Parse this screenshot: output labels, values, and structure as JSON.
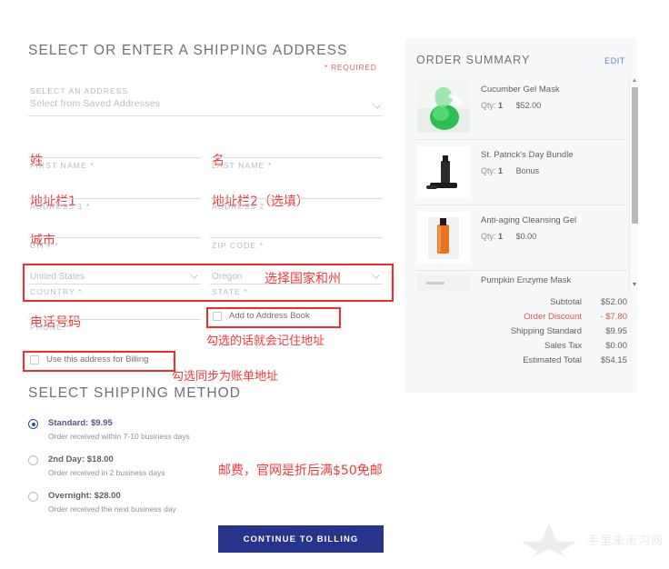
{
  "shipping_section": {
    "title": "SELECT OR ENTER A SHIPPING ADDRESS",
    "required_note": "* REQUIRED",
    "saved_address": {
      "label": "SELECT AN ADDRESS",
      "value": "Select from Saved Addresses"
    },
    "fields": [
      {
        "label": "FIRST NAME *",
        "value": "姓",
        "value_lang": "cn"
      },
      {
        "label": "LAST NAME *",
        "value": "名",
        "value_lang": "cn"
      },
      {
        "label": "ADDRESS 1 *",
        "value": "地址栏1",
        "value_lang": "cn"
      },
      {
        "label": "ADDRESS 2",
        "value": "地址栏2（选填）",
        "value_lang": "cn"
      },
      {
        "label": "CITY *",
        "value": "城市",
        "value_lang": "cn"
      },
      {
        "label": "ZIP CODE *",
        "value": "",
        "value_lang": "cn"
      },
      {
        "label": "COUNTRY *",
        "value": "United States",
        "value_lang": "en"
      },
      {
        "label": "STATE *",
        "value": "Oregon",
        "value_lang": "en"
      },
      {
        "label": "PHONE *",
        "value": "电话号码",
        "value_lang": "cn"
      }
    ],
    "checkboxes": [
      {
        "label": "Add to Address Book",
        "checked": false
      },
      {
        "label": "Use this address for Billing",
        "checked": false
      }
    ]
  },
  "shipping_method": {
    "title": "SELECT SHIPPING METHOD",
    "options": [
      {
        "name": "Standard: $9.95",
        "desc": "Order received within 7-10 business days",
        "selected": true
      },
      {
        "name": "2nd Day: $18.00",
        "desc": "Order received in 2 business days",
        "selected": false
      },
      {
        "name": "Overnight: $28.00",
        "desc": "Order received the next business day",
        "selected": false
      }
    ]
  },
  "continue_button": {
    "label": "CONTINUE TO BILLING"
  },
  "order_summary": {
    "title": "ORDER SUMMARY",
    "edit_label": "EDIT",
    "items": [
      {
        "name": "Cucumber Gel Mask",
        "qty_label": "Qty:",
        "qty": "1",
        "price": "$52.00",
        "thumb": "cucumber-gel-mask-thumb"
      },
      {
        "name": "St. Patrick's Day Bundle",
        "qty_label": "Qty:",
        "qty": "1",
        "price": "Bonus",
        "thumb": "st-patricks-bundle-thumb"
      },
      {
        "name": "Anti-aging Cleansing Gel",
        "qty_label": "Qty:",
        "qty": "1",
        "price": "$0.00",
        "thumb": "anti-aging-cleansing-gel-thumb"
      },
      {
        "name": "Pumpkin Enzyme Mask",
        "qty_label": "",
        "qty": "",
        "price": "",
        "thumb": "pumpkin-enzyme-mask-thumb"
      }
    ],
    "totals": [
      {
        "label": "Subtotal",
        "value": "$52.00",
        "kind": "normal"
      },
      {
        "label": "Order Discount",
        "value": "- $7.80",
        "kind": "discount"
      },
      {
        "label": "Shipping Standard",
        "value": "$9.95",
        "kind": "normal"
      },
      {
        "label": "Sales Tax",
        "value": "$0.00",
        "kind": "normal"
      },
      {
        "label": "Estimated Total",
        "value": "$54.15",
        "kind": "normal"
      }
    ]
  },
  "annotations": {
    "country_state": "选择国家和州",
    "address_book_note": "勾选的话就会记住地址",
    "billing_note": "勾选同步为账单地址",
    "shipping_note": "邮费，官网是折后满$50免邮"
  },
  "watermark": {
    "text": "手里未洧沟网"
  },
  "colors": {
    "accent_blue": "#26348c",
    "annotation_red": "#ee3a3a",
    "label_gray": "#b4bac0",
    "discount_red": "#e05252",
    "panel_bg": "#f7f8f9"
  }
}
